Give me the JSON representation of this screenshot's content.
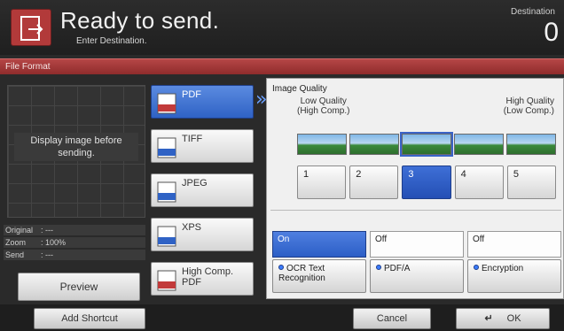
{
  "header": {
    "title": "Ready to send.",
    "subtitle": "Enter Destination.",
    "destination_label": "Destination",
    "destination_count": "0"
  },
  "section_title": "File Format",
  "preview": {
    "message": "Display image before sending.",
    "original_label": "Original",
    "original_value": ": ---",
    "zoom_label": "Zoom",
    "zoom_value": ": 100%",
    "send_label": "Send",
    "send_value": ": ---",
    "button_label": "Preview"
  },
  "formats": [
    {
      "label": "PDF",
      "selected": true
    },
    {
      "label": "TIFF",
      "selected": false
    },
    {
      "label": "JPEG",
      "selected": false
    },
    {
      "label": "XPS",
      "selected": false
    },
    {
      "label": "High Comp. PDF",
      "selected": false
    }
  ],
  "image_quality": {
    "title": "Image Quality",
    "low_line1": "Low Quality",
    "low_line2": "(High Comp.)",
    "high_line1": "High Quality",
    "high_line2": "(Low Comp.)",
    "levels": [
      "1",
      "2",
      "3",
      "4",
      "5"
    ],
    "selected_level": "3"
  },
  "options": {
    "ocr_status": "On",
    "pdfa_status": "Off",
    "encryption_status": "Off",
    "ocr_label_1": "OCR Text",
    "ocr_label_2": "Recognition",
    "pdfa_label": "PDF/A",
    "encryption_label": "Encryption"
  },
  "footer": {
    "add_shortcut": "Add Shortcut",
    "cancel": "Cancel",
    "ok": "OK"
  },
  "colors": {
    "accent_red": "#b54646",
    "selected_blue": "#2f62c5"
  }
}
